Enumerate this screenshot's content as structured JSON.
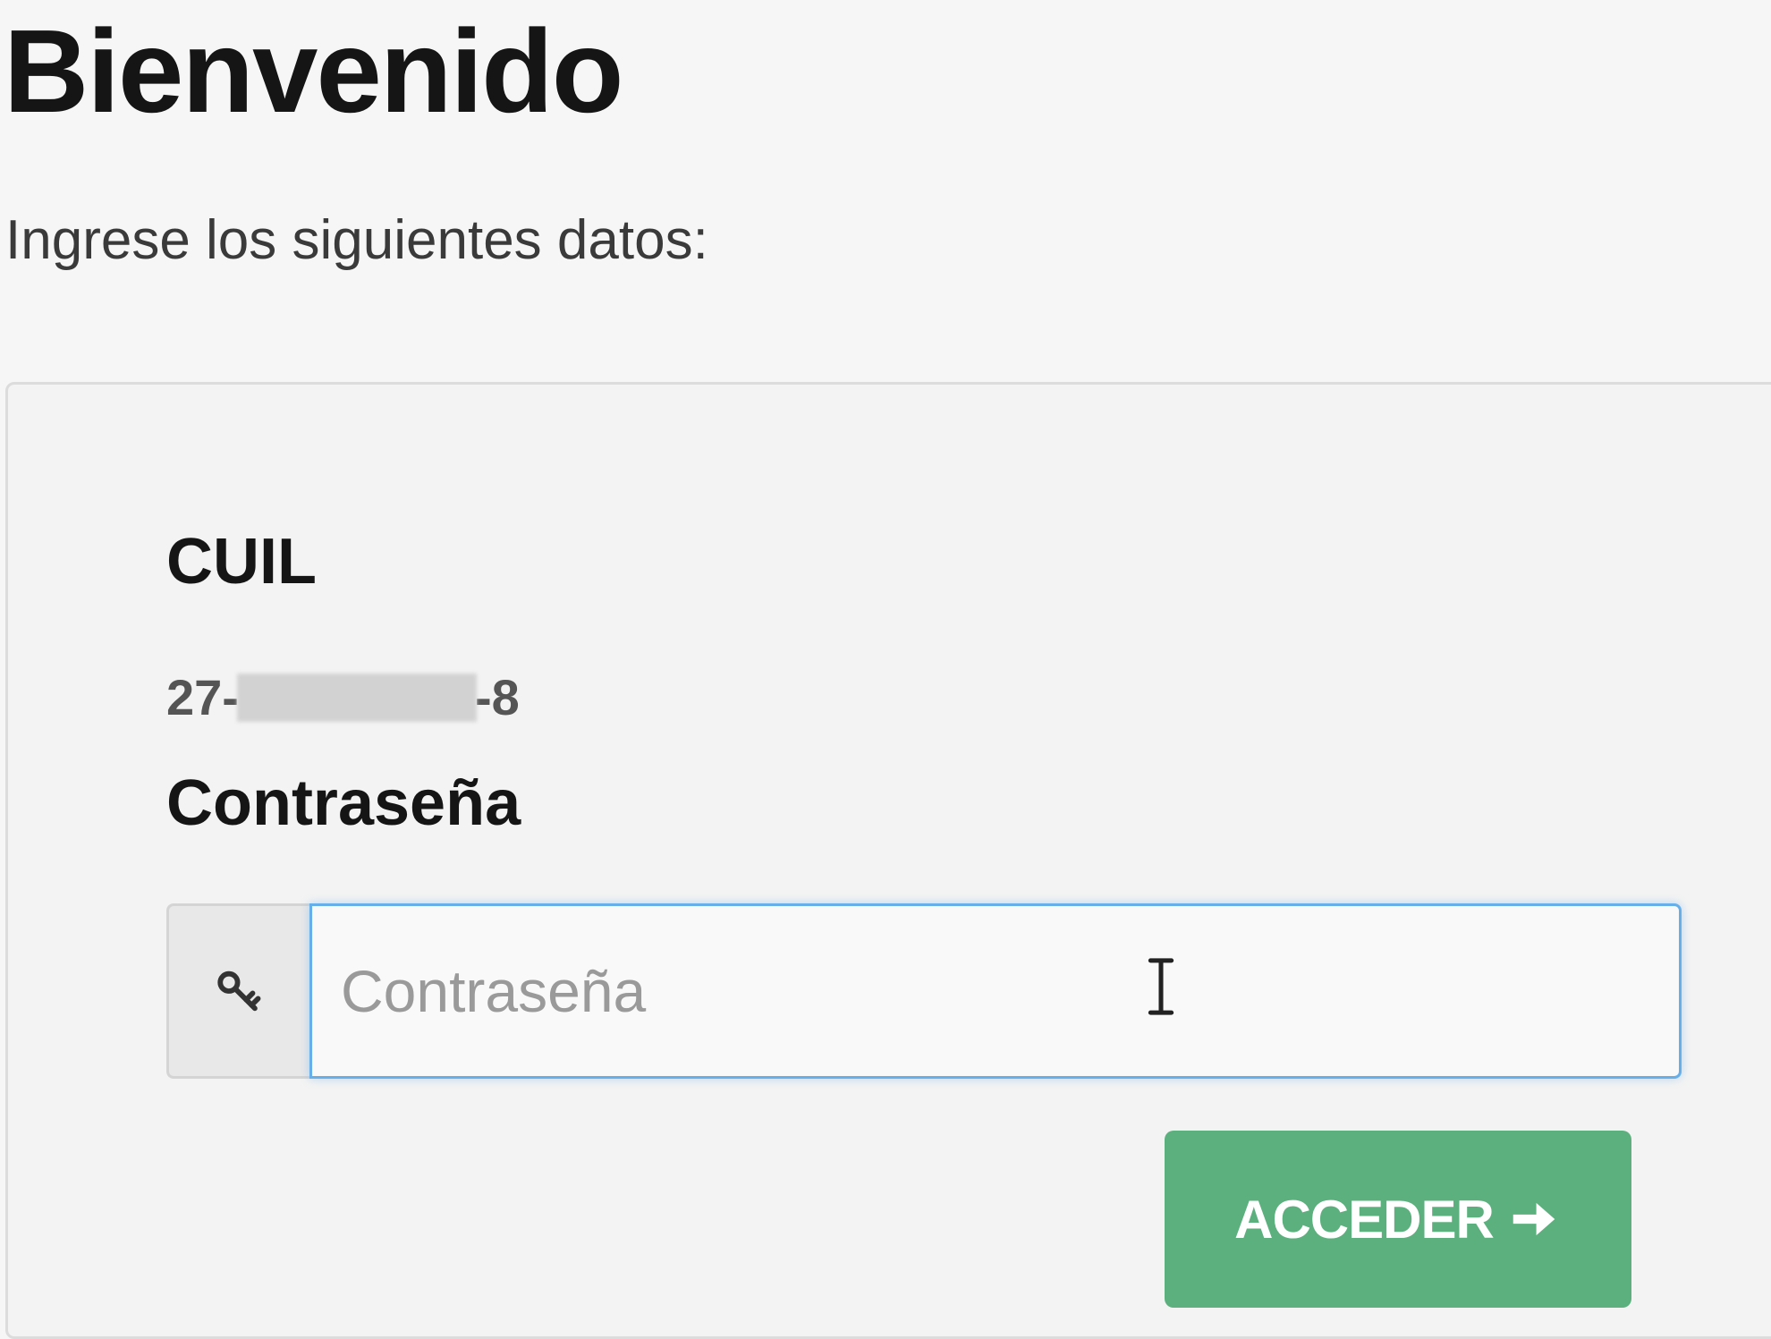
{
  "header": {
    "title": "Bienvenido",
    "subtitle": "Ingrese los siguientes datos:"
  },
  "form": {
    "cuil_label": "CUIL",
    "cuil_prefix": "27-",
    "cuil_suffix": "-8",
    "password_label": "Contraseña",
    "password_placeholder": "Contraseña",
    "password_value": "",
    "submit_label": "ACCEDER"
  },
  "icons": {
    "password_addon": "key-icon",
    "submit": "arrow-right-icon",
    "cursor": "text-cursor-icon"
  },
  "colors": {
    "background": "#f6f6f6",
    "panel": "#f3f3f3",
    "button": "#5cb07e",
    "focus_border": "#66afe9",
    "title_text": "#151515"
  }
}
